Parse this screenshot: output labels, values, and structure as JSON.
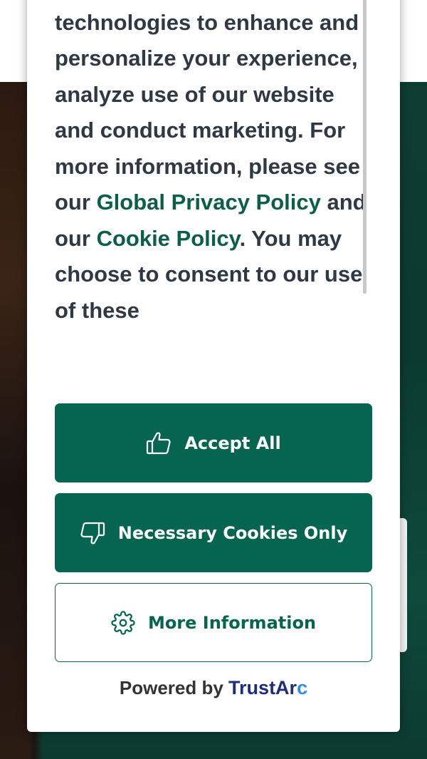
{
  "consent": {
    "text_segments": [
      {
        "text": "party cookies and similar technologies to enhance and personalize your experience, analyze use of our website and conduct marketing. For more information, please see our ",
        "link": false
      },
      {
        "text": "Global Privacy Policy",
        "link": true
      },
      {
        "text": " and our ",
        "link": false
      },
      {
        "text": "Cookie Policy",
        "link": true
      },
      {
        "text": ". You may choose to consent to our use of these",
        "link": false
      }
    ]
  },
  "buttons": {
    "accept_all": {
      "label": "Accept All",
      "icon": "thumbs-up-icon"
    },
    "necessary_only": {
      "label": "Necessary Cookies Only",
      "icon": "thumbs-down-icon"
    },
    "more_info": {
      "label": "More Information",
      "icon": "gear-icon"
    }
  },
  "footer": {
    "powered_by": "Powered by",
    "brand_main": "TrustAr",
    "brand_accent": "c"
  },
  "colors": {
    "primary": "#066551",
    "link": "#0b5e47",
    "text": "#2f3845",
    "brand": "#1d2e7a"
  }
}
